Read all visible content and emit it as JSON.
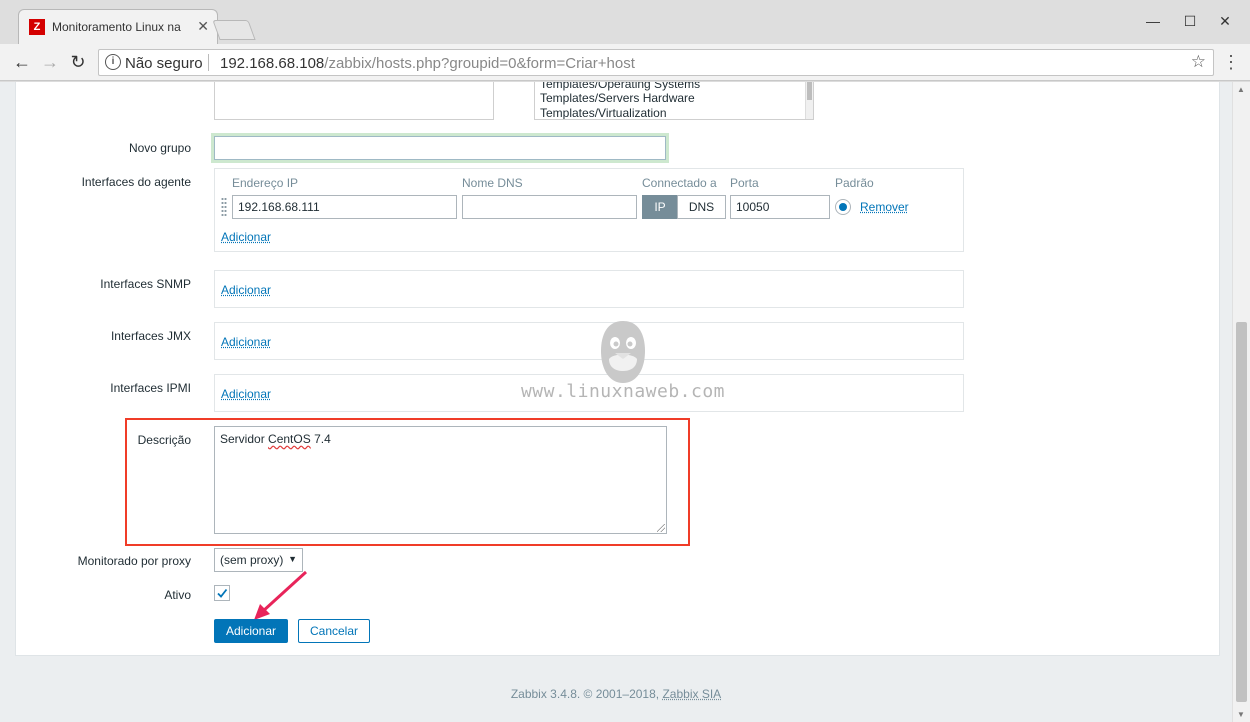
{
  "browser": {
    "tab_title": "Monitoramento Linux na",
    "favicon_letter": "Z",
    "security_label": "Não seguro",
    "url_host": "192.168.68.108",
    "url_path": "/zabbix/hosts.php?groupid=0&form=Criar+host",
    "window_controls": [
      "minimize-icon",
      "maximize-icon",
      "close-icon"
    ]
  },
  "groups": {
    "other_groups": [
      "Templates/Operating Systems",
      "Templates/Servers Hardware",
      "Templates/Virtualization"
    ]
  },
  "form": {
    "new_group_label": "Novo grupo",
    "new_group_value": "",
    "agent_interfaces_label": "Interfaces do agente",
    "columns": {
      "ip": "Endereço IP",
      "dns": "Nome DNS",
      "connect": "Connectado a",
      "port": "Porta",
      "default": "Padrão"
    },
    "agent_interface": {
      "ip": "192.168.68.111",
      "dns": "",
      "connect_ip": "IP",
      "connect_dns": "DNS",
      "connect_selected": "IP",
      "port": "10050",
      "remove": "Remover"
    },
    "add_link": "Adicionar",
    "snmp_label": "Interfaces SNMP",
    "jmx_label": "Interfaces JMX",
    "ipmi_label": "Interfaces IPMI",
    "description_label": "Descrição",
    "description_word1": "Servidor",
    "description_word2": "CentOS",
    "description_word3": "7.4",
    "proxy_label": "Monitorado por proxy",
    "proxy_value": "(sem proxy)",
    "enabled_label": "Ativo",
    "enabled": true,
    "submit_button": "Adicionar",
    "cancel_button": "Cancelar"
  },
  "watermark": "www.linuxnaweb.com",
  "footer": {
    "text": "Zabbix 3.4.8. © 2001–2018,",
    "company": "Zabbix SIA"
  },
  "colors": {
    "accent": "#0275b8",
    "highlight": "#f03c28",
    "segment_active": "#768d99"
  }
}
